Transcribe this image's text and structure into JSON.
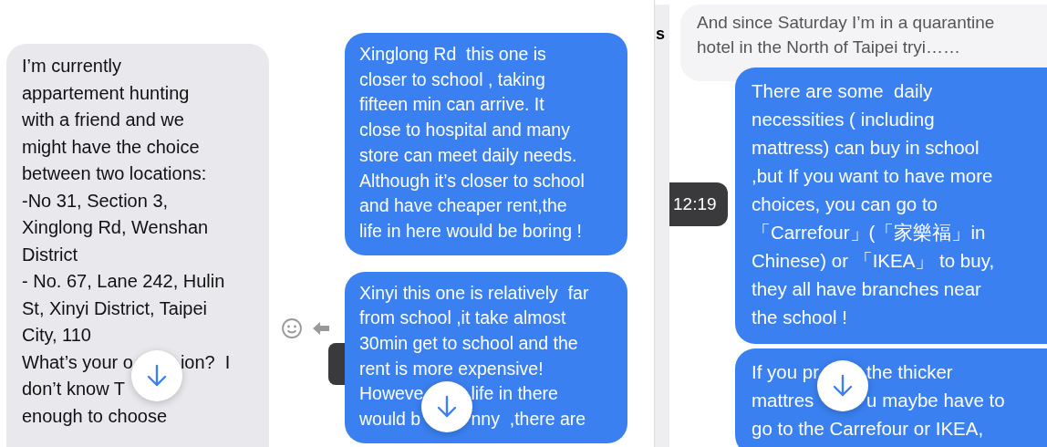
{
  "panels": [
    {
      "messages": [
        {
          "kind": "incoming",
          "text": "I’m currently\nappartement hunting\nwith a friend and we\nmight have the choice\nbetween two locations:\n-No 31, Section 3,\nXinglong Rd, Wenshan\nDistrict\n- No. 67, Lane 242, Hulin\nSt, Xinyi District, Taipei\nCity, 110",
          "tail": [
            {
              "left": "What’s your o",
              "right": "ion?  I"
            },
            {
              "left": "don’t know T"
            }
          ],
          "after": "enough to choose"
        }
      ]
    },
    {
      "messages": [
        {
          "kind": "outgoing",
          "text": "Xinglong Rd  this one is\ncloser to school , taking\nfifteen min can arrive. It\nclose to hospital and many\nstore can meet daily needs.\nAlthough it’s closer to school\nand have cheaper rent,the\nlife in here would be boring !"
        },
        {
          "kind": "outgoing",
          "hover_actions": true,
          "text": "Xinyi this one is relatively  far\nfrom school ,it take almost\n30min get to school and the\nrent is more expensive!",
          "tail": [
            {
              "left": "Howeve",
              "right": "life in there"
            },
            {
              "left": "would b",
              "right": "nny  ,there are"
            }
          ]
        }
      ]
    },
    {
      "sidebar_fragment": "s",
      "messages": [
        {
          "kind": "preview",
          "text": "And since Saturday I’m in a quarantine\nhotel in the North of Taipei tryi……"
        },
        {
          "kind": "outgoing",
          "time": "12:19",
          "text": "There are some  daily\nnecessities ( including\nmattress) can buy in school\n,but If you want to have more\nchoices, you can go to\n「Carrefour」(「家樂福」in\nChinese) or 「IKEA」 to buy,\nthey all have branches near\nthe school !"
        },
        {
          "kind": "outgoing",
          "tail": [
            {
              "left": "If you pr",
              "right": "the thicker"
            },
            {
              "left": "mattres",
              "right": "u maybe have to"
            }
          ],
          "after": "go to the Carrefour or IKEA,"
        }
      ]
    }
  ]
}
